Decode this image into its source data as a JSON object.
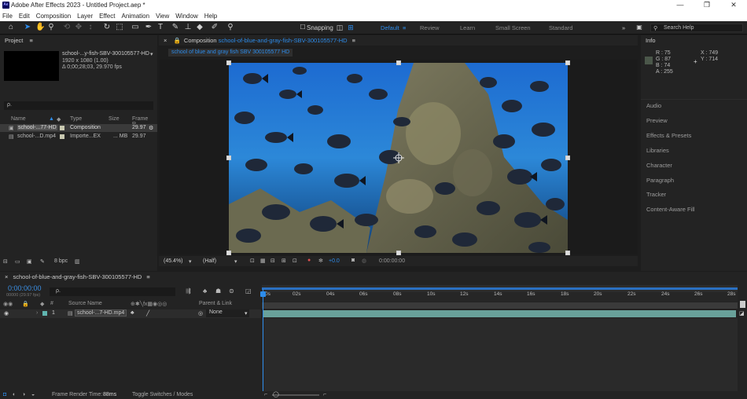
{
  "app": {
    "title": "Adobe After Effects 2023 - Untitled Project.aep *",
    "logo": "Ae"
  },
  "window_controls": [
    "—",
    "❐",
    "✕"
  ],
  "menu": [
    "File",
    "Edit",
    "Composition",
    "Layer",
    "Effect",
    "Animation",
    "View",
    "Window",
    "Help"
  ],
  "toolbar": {
    "snapping": "Snapping",
    "workspaces": {
      "active": "Default",
      "items": [
        "Review",
        "Learn",
        "Small Screen",
        "Standard"
      ]
    },
    "search_placeholder": "Search Help"
  },
  "project": {
    "panel_title": "Project",
    "item_name": "school-...y-fish-SBV-300105577-HD",
    "item_dims": "1920 x 1080 (1.00)",
    "item_duration": "Δ 0;00;28;03, 29.970 fps",
    "search_placeholder": "ρ.",
    "columns": [
      "Name",
      "Type",
      "Size",
      "Frame R..."
    ],
    "rows": [
      {
        "name": "school-...77-HD",
        "type": "Composition",
        "size": "",
        "fps": "29.97"
      },
      {
        "name": "school-...D.mp4",
        "type": "Importe...EX",
        "size": "... MB",
        "fps": "29.97"
      }
    ],
    "bpc": "8 bpc"
  },
  "composition": {
    "panel_title": "Composition",
    "comp_name": "school-of-blue-and-gray-fish-SBV-300105577-HD",
    "tab_label": "school of blue and gray fish SBV 300105577 HD",
    "zoom": "(45.4%)",
    "resolution": "(Half)",
    "exposure": "+0.0",
    "timecode": "0:00:00:00"
  },
  "info": {
    "panel_title": "Info",
    "r": "R : 75",
    "g": "G : 87",
    "b": "B : 74",
    "a": "A : 255",
    "x": "X : 749",
    "y": "Y : 714",
    "swatch_color": "#4b574a"
  },
  "right_panels": [
    "Audio",
    "Preview",
    "Effects & Presets",
    "Libraries",
    "Character",
    "Paragraph",
    "Tracker",
    "Content-Aware Fill"
  ],
  "timeline": {
    "tab": "school-of-blue-and-gray-fish-SBV-300105577-HD",
    "timecode": "0:00:00:00",
    "frame_info": "00000 (29.97 fps)",
    "search_placeholder": "ρ.",
    "col_source": "Source Name",
    "col_parent": "Parent & Link",
    "layer": {
      "index": "1",
      "name": "school-...7-HD.mp4",
      "parent": "None"
    },
    "ruler": [
      "0s",
      "02s",
      "04s",
      "06s",
      "08s",
      "10s",
      "12s",
      "14s",
      "16s",
      "18s",
      "20s",
      "22s",
      "24s",
      "26s",
      "28s"
    ]
  },
  "status": {
    "render_label": "Frame Render Time:",
    "render_value": "88ms",
    "toggle_label": "Toggle Switches / Modes"
  },
  "colors": {
    "accent": "#2d8ceb",
    "timecode_blue": "#3b8de0",
    "layer_bar": "#69a19a",
    "label_teal": "#60b5b0"
  }
}
